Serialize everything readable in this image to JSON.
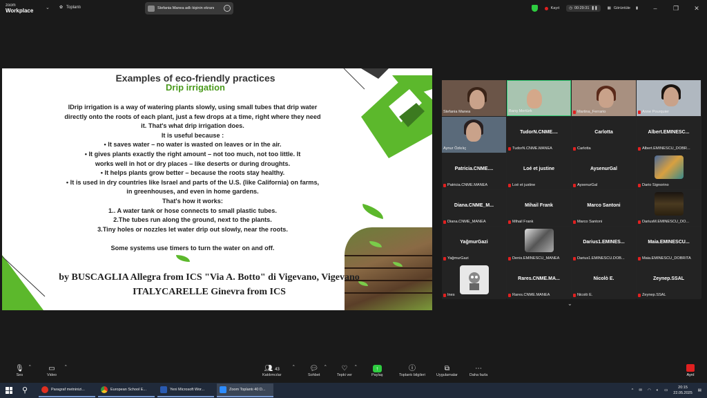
{
  "titlebar": {
    "logo_top": "zoom",
    "logo_bottom": "Workplace",
    "meeting_label": "Toplantı",
    "share_banner": "Stefania Manea adlı kişinin ekranı",
    "recording": "Kayıt",
    "timer": "00:29:31",
    "view": "Görüntüle"
  },
  "slide": {
    "title": "Examples of eco-friendly practices",
    "subtitle": "Drip irrigation",
    "lines": [
      "lDrip irrigation is a way of watering plants slowly, using small tubes that drip water",
      "directly onto the roots of each plant, just a few drops at a time, right where they need",
      "it. That's what drip irrigation does.",
      "It is useful because :",
      "•        It saves water – no water is wasted on leaves or in the air.",
      "•      It gives plants exactly the right amount – not too much, not too little. It",
      "works well in hot or dry places – like deserts or during droughts.",
      "•     It helps plants grow better – because the roots stay healthy.",
      "•     It is used in dry countries like Israel and parts of the U.S. (like California) on farms,",
      "in greenhouses, and even in home gardens.",
      "That's how it works:",
      "1.. A water tank or hose connects to small plastic tubes.",
      "2.The tubes run along the ground, next to the plants.",
      "3.Tiny holes or nozzles let water drip out slowly, near the roots.",
      "",
      "Some systems use timers to turn the water on and off."
    ],
    "author_line1": "by BUSCAGLIA Allegra from ICS \"Via A. Botto\" di Vigevano, Vigevano",
    "author_line2": "ITALYCARELLE Ginevra from ICS"
  },
  "participants": [
    {
      "name": "",
      "label": "Stefania Manea",
      "video": true,
      "muted": false
    },
    {
      "name": "",
      "label": "Barış Mertürk",
      "video": true,
      "muted": false,
      "active": true
    },
    {
      "name": "",
      "label": "Martina_Ferrario",
      "video": true,
      "muted": true
    },
    {
      "name": "",
      "label": "Anne Pourquier",
      "video": true,
      "muted": true
    },
    {
      "name": "",
      "label": "Aynur Özkılıç",
      "video": true,
      "muted": false
    },
    {
      "name": "TudorN.CNME....",
      "label": "TudorN.CNME.MANEA",
      "video": false,
      "muted": true
    },
    {
      "name": "Carlotta",
      "label": "Carlotta",
      "video": false,
      "muted": true
    },
    {
      "name": "Albert.EMINESC...",
      "label": "Albert.EMINESCU_DOBR...",
      "video": false,
      "muted": true
    },
    {
      "name": "Patricia.CNME....",
      "label": "Patricia.CNME.MANEA",
      "video": false,
      "muted": true
    },
    {
      "name": "Loé et justine",
      "label": "Loé et justine",
      "video": false,
      "muted": true
    },
    {
      "name": "AysenurGal",
      "label": "AysenurGal",
      "video": false,
      "muted": true
    },
    {
      "name": "",
      "label": "Dario Signorino",
      "video": false,
      "muted": true,
      "avatar": "#4a6a9a"
    },
    {
      "name": "Diana.CNME_M...",
      "label": "Diana.CNME_MANEA",
      "video": false,
      "muted": true
    },
    {
      "name": "Mihail Frank",
      "label": "Mihail Frank",
      "video": false,
      "muted": true
    },
    {
      "name": "Marco Santoni",
      "label": "Marco Santoni",
      "video": false,
      "muted": true
    },
    {
      "name": "",
      "label": "DariusM.EMINESCU_DO...",
      "video": false,
      "muted": true,
      "avatar": "#3a3020"
    },
    {
      "name": "YağmurGazi",
      "label": "YağmurGazi",
      "video": false,
      "muted": true
    },
    {
      "name": "",
      "label": "Denis.EMINESCU_MANEA",
      "video": false,
      "muted": true,
      "avatar": "#8a8a8a"
    },
    {
      "name": "Darius1.EMINES...",
      "label": "Darius1.EMINESCU.DOB...",
      "video": false,
      "muted": true
    },
    {
      "name": "Maia.EMINESCU...",
      "label": "Maia.EMINESCU_DOBRITA",
      "video": false,
      "muted": true
    },
    {
      "name": "",
      "label": "Ines",
      "video": false,
      "muted": true,
      "avatar": "#e8e8e8"
    },
    {
      "name": "Rares.CNME.MA...",
      "label": "Rares.CNME.MANEA",
      "video": false,
      "muted": true
    },
    {
      "name": "Nicolò E.",
      "label": "Nicolò E.",
      "video": false,
      "muted": true
    },
    {
      "name": "Zeynep.SSAL",
      "label": "Zeynep.SSAL",
      "video": false,
      "muted": true
    }
  ],
  "toolbar": {
    "audio": "Ses",
    "video": "Video",
    "participants": "Katılımcılar",
    "participant_count": "43",
    "chat": "Sohbet",
    "react": "Tepki ver",
    "share": "Paylaş",
    "info": "Toplantı bilgileri",
    "apps": "Uygulamalar",
    "more": "Daha fazla",
    "leave": "Ayrıl"
  },
  "taskbar": {
    "apps": [
      {
        "label": "Paragraf metninizi...",
        "color": "#e03020"
      },
      {
        "label": "European School E...",
        "color": "#3a9a3a"
      },
      {
        "label": "Yeni Microsoft Wor...",
        "color": "#2a5ab0"
      },
      {
        "label": "Zoom Toplantı 40 D...",
        "color": "#2d8cff"
      }
    ],
    "time": "20:15",
    "date": "22.05.2025"
  },
  "colors": {
    "accent_green": "#5cb82c",
    "title_green": "#4a9a1c",
    "active_speaker": "#2ecc71",
    "record_red": "#e02020"
  }
}
